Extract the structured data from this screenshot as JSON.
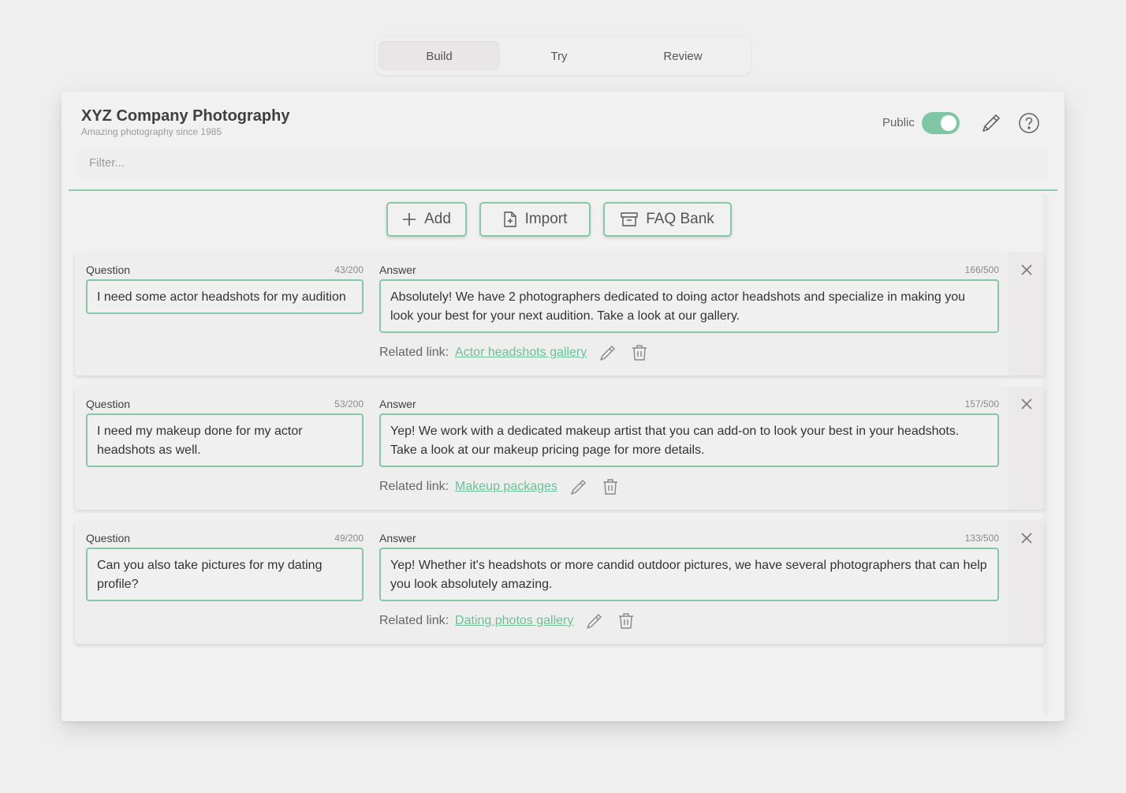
{
  "tabs": [
    {
      "label": "Build",
      "active": true
    },
    {
      "label": "Try",
      "active": false
    },
    {
      "label": "Review",
      "active": false
    }
  ],
  "header": {
    "title": "XYZ Company Photography",
    "subtitle": "Amazing photography since 1985",
    "public_label": "Public",
    "public_enabled": true
  },
  "filter": {
    "placeholder": "Filter...",
    "value": ""
  },
  "actions": {
    "add": "Add",
    "import": "Import",
    "faq_bank": "FAQ Bank"
  },
  "labels": {
    "question": "Question",
    "answer": "Answer",
    "related_link": "Related link:"
  },
  "items": [
    {
      "question": "I need some actor headshots for my audition",
      "question_count": "43/200",
      "answer": "Absolutely! We have 2 photographers dedicated to doing actor headshots and specialize in making you look your best for your next audition. Take a look at our gallery.",
      "answer_count": "166/500",
      "related_link": "Actor headshots gallery"
    },
    {
      "question": "I need my makeup done for my actor headshots as well.",
      "question_count": "53/200",
      "answer": "Yep! We work with a dedicated makeup artist that you can add-on to look your best in your headshots. Take a look at our makeup pricing page for more details.",
      "answer_count": "157/500",
      "related_link": "Makeup packages"
    },
    {
      "question": "Can you also take pictures for my dating profile?",
      "question_count": "49/200",
      "answer": "Yep! Whether it's headshots or more candid outdoor pictures, we have several photographers that can help you look absolutely amazing.",
      "answer_count": "133/500",
      "related_link": "Dating photos gallery"
    }
  ],
  "colors": {
    "accent": "#86c7a9",
    "link": "#6cbf98",
    "toggle_on": "#7fc6a4"
  }
}
